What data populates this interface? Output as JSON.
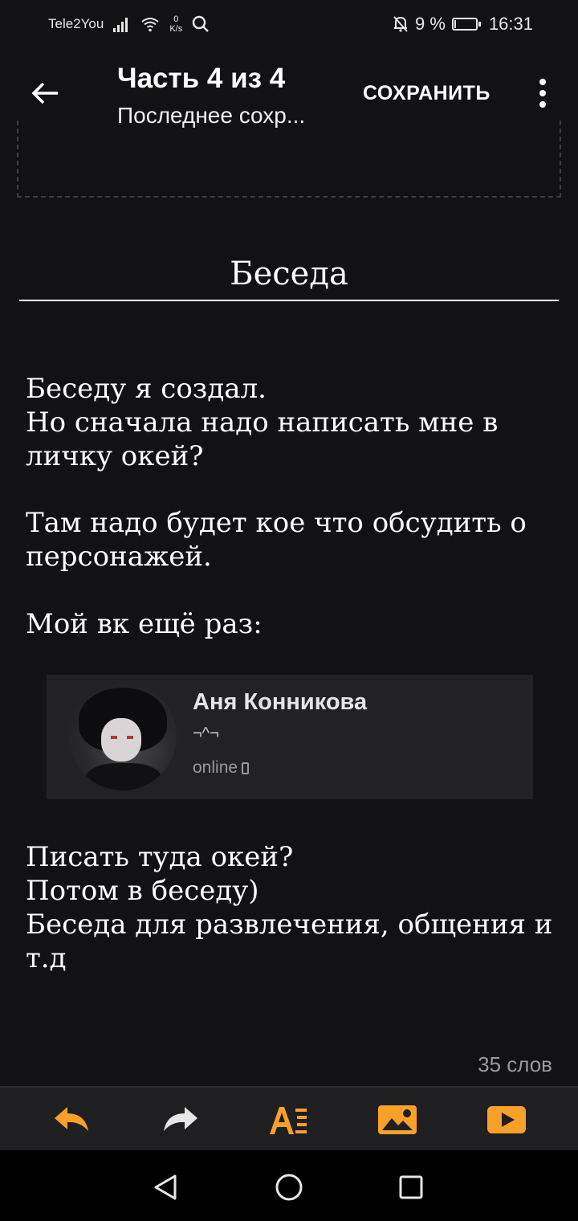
{
  "status_bar": {
    "carrier": "Tele2You",
    "speed_value": "0",
    "speed_unit": "K/s",
    "battery_text": "9 %",
    "battery_level": 0.09,
    "time": "16:31",
    "icons": [
      "signal-icon",
      "wifi-icon",
      "search-icon",
      "notifications-off-icon",
      "battery-icon"
    ]
  },
  "app_bar": {
    "title": "Часть 4 из 4",
    "subtitle": "Последнее сохр...",
    "save_label": "СОХРАНИТЬ"
  },
  "content": {
    "heading": "Беседа",
    "paragraphs": [
      [
        "Беседу я создал.",
        "Но сначала надо написать мне в",
        "личку окей?"
      ],
      [
        "Там надо будет кое что обсудить о",
        "персонажей."
      ],
      [
        "Мой вк ещё раз:"
      ],
      [
        "Писать туда окей?",
        "Потом в беседу)",
        "Беседа для развлечения, общения и",
        "т.д"
      ]
    ],
    "profile_card": {
      "name": "Аня Конникова",
      "status": "¬^¬",
      "online": "online"
    },
    "word_count": "35 слов"
  },
  "colors": {
    "background": "#121114",
    "accent": "#f7a02a",
    "toolbar_bg": "#1f1f22"
  },
  "toolbar": [
    "undo-icon",
    "redo-icon",
    "text-format-icon",
    "insert-image-icon",
    "insert-video-icon"
  ],
  "nav_bar": [
    "nav-back-icon",
    "nav-home-icon",
    "nav-recents-icon"
  ]
}
